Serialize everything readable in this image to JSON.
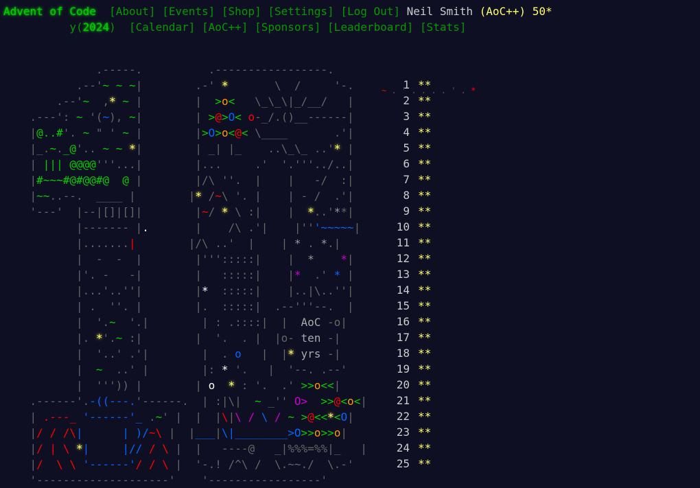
{
  "header": {
    "site_title": "Advent of Code",
    "year_prefix": "y(",
    "year": "2024",
    "year_suffix": ")",
    "nav_row1": [
      "[About]",
      "[Events]",
      "[Shop]",
      "[Settings]",
      "[Log Out]"
    ],
    "nav_row2": [
      "[Calendar]",
      "[AoC++]",
      "[Sponsors]",
      "[Leaderboard]",
      "[Stats]"
    ],
    "user_name": "Neil Smith",
    "supporter_badge": "(AoC++)",
    "star_count": "50*"
  },
  "calendar": {
    "days": [
      {
        "day": "1",
        "stars": "**"
      },
      {
        "day": "2",
        "stars": "**"
      },
      {
        "day": "3",
        "stars": "**"
      },
      {
        "day": "4",
        "stars": "**"
      },
      {
        "day": "5",
        "stars": "**"
      },
      {
        "day": "6",
        "stars": "**"
      },
      {
        "day": "7",
        "stars": "**"
      },
      {
        "day": "8",
        "stars": "**"
      },
      {
        "day": "9",
        "stars": "**"
      },
      {
        "day": "10",
        "stars": "**"
      },
      {
        "day": "11",
        "stars": "**"
      },
      {
        "day": "12",
        "stars": "**"
      },
      {
        "day": "13",
        "stars": "**"
      },
      {
        "day": "14",
        "stars": "**"
      },
      {
        "day": "15",
        "stars": "**"
      },
      {
        "day": "16",
        "stars": "**"
      },
      {
        "day": "17",
        "stars": "**"
      },
      {
        "day": "18",
        "stars": "**"
      },
      {
        "day": "19",
        "stars": "**"
      },
      {
        "day": "20",
        "stars": "**"
      },
      {
        "day": "21",
        "stars": "**"
      },
      {
        "day": "22",
        "stars": "**"
      },
      {
        "day": "23",
        "stars": "**"
      },
      {
        "day": "24",
        "stars": "**"
      },
      {
        "day": "25",
        "stars": "**"
      }
    ],
    "aoc_box": [
      "AoC",
      "ten",
      "yrs"
    ]
  },
  "colors": {
    "background": "#0f0f23",
    "title_green": "#00cc00",
    "link_green": "#009900",
    "star_yellow": "#ffff66",
    "text_gray": "#cccccc"
  }
}
